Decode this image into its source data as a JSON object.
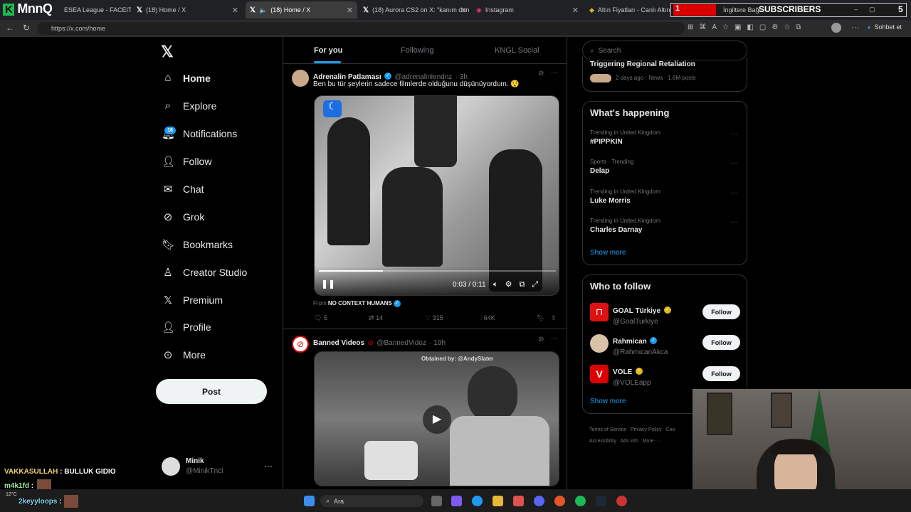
{
  "browser": {
    "tabs": [
      {
        "label": "ESEA League - FACEIT"
      },
      {
        "label": "(18) Home / X"
      },
      {
        "label": "(18) Home / X"
      },
      {
        "label": "(18) Aurora CS2 on X: \"kanım don"
      },
      {
        "label": "Instagram"
      },
      {
        "label": "Altın Fiyatları - Canlı Altın Ku"
      },
      {
        "label": "İngiltere Bağımsızl"
      }
    ],
    "url": "https://x.com/home",
    "copilot_label": "Sohbet et"
  },
  "overlay": {
    "logo": "MnnQ",
    "subscribers_label": "SUBSCRIBERS",
    "subscribers_left": "1",
    "subscribers_right": "5",
    "chat": [
      {
        "user": "VAKKASULLAH",
        "text": "BULLUK GIDIO"
      },
      {
        "user": "m4k1fd",
        "text": ""
      },
      {
        "user": "2keyyloops",
        "text": ""
      }
    ]
  },
  "nav": {
    "items": [
      "Home",
      "Explore",
      "Notifications",
      "Follow",
      "Chat",
      "Grok",
      "Bookmarks",
      "Creator Studio",
      "Premium",
      "Profile",
      "More"
    ],
    "notif_badge": "18",
    "post_label": "Post",
    "account": {
      "name": "Minik",
      "handle": "@MinikTncl"
    }
  },
  "feed": {
    "tabs": [
      "For you",
      "Following",
      "KNGL Social"
    ],
    "posts": [
      {
        "name": "Adrenalin Patlaması",
        "handle": "@adrenalinlendnz",
        "time": "· 3h",
        "text": "Ben bu tür şeylerin sadece filmlerde olduğunu düşünüyordum. 😯",
        "video_time": "0:03 / 0:11",
        "progress": 0.27,
        "from_label": "From",
        "from_source": "NO CONTEXT HUMANS",
        "replies": "5",
        "reposts": "14",
        "likes": "315",
        "views": "64K"
      },
      {
        "name": "Banned Videos",
        "handle": "@BannedVidoz",
        "time": "· 19h",
        "watermark": "Obtained by: @AndySlater"
      }
    ]
  },
  "right": {
    "search_placeholder": "Search",
    "top_news": {
      "title": "Triggering Regional Retaliation",
      "meta": "2 days ago · News · 1.6M posts"
    },
    "whats_happening": {
      "title": "What's happening",
      "trends": [
        {
          "context": "Trending in United Kingdom",
          "topic": "#PIPPKIN"
        },
        {
          "context": "Sports · Trending",
          "topic": "Delap"
        },
        {
          "context": "Trending in United Kingdom",
          "topic": "Luke Morris"
        },
        {
          "context": "Trending in United Kingdom",
          "topic": "Charles Darnay"
        }
      ],
      "show_more": "Show more"
    },
    "who_to_follow": {
      "title": "Who to follow",
      "accounts": [
        {
          "name": "GOAL Türkiye",
          "handle": "@GoalTurkiye"
        },
        {
          "name": "Rahmican",
          "handle": "@RahmicanAkca"
        },
        {
          "name": "VOLE",
          "handle": "@VOLEapp"
        }
      ],
      "follow_label": "Follow",
      "show_more": "Show more"
    },
    "footer": [
      "Terms of Service",
      "Privacy Policy",
      "Coo",
      "Accessibility",
      "Ads info",
      "More ···"
    ]
  },
  "taskbar": {
    "search": "Ara",
    "temp": "12°C"
  },
  "colors": {
    "accent": "#1d9bf0",
    "bg": "#000000",
    "border": "#2f3336",
    "muted": "#71767b"
  }
}
